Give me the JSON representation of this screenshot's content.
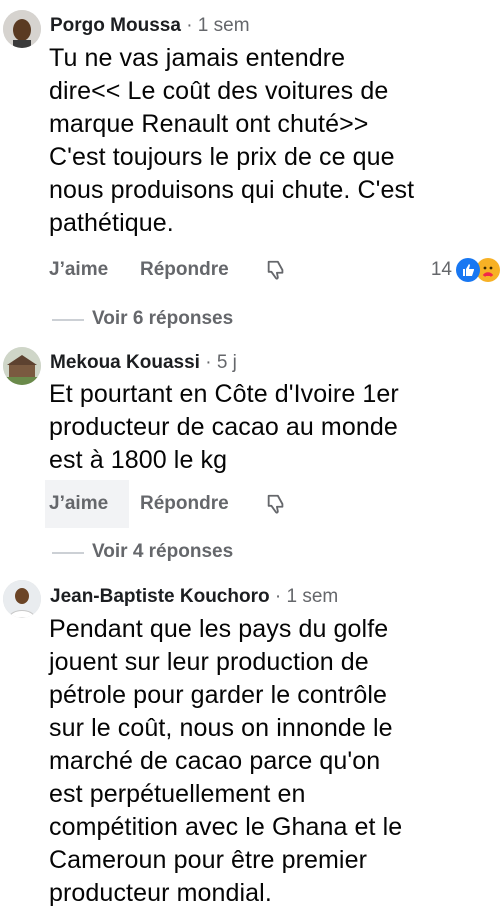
{
  "comments": [
    {
      "author": "Porgo Moussa",
      "separator": "·",
      "time": "1 sem",
      "text_lines": [
        "Tu ne vas jamais entendre",
        "dire<< Le coût des voitures de",
        "marque Renault ont chuté>>",
        "C'est toujours le prix de ce que",
        "nous produisons qui chute. C'est",
        "pathétique."
      ],
      "like_label": "J’aime",
      "reply_label": "Répondre",
      "reaction_count": "14",
      "reactions": [
        "like-reaction-icon",
        "care-reaction-icon"
      ],
      "view_replies": "Voir 6 réponses"
    },
    {
      "author": "Mekoua Kouassi",
      "separator": "·",
      "time": "5 j",
      "text_lines": [
        "Et pourtant en Côte d'Ivoire 1er",
        "producteur de cacao au monde",
        "est à 1800 le kg"
      ],
      "like_label": "J’aime",
      "reply_label": "Répondre",
      "view_replies": "Voir 4 réponses"
    },
    {
      "author": "Jean-Baptiste Kouchoro",
      "separator": "·",
      "time": "1 sem",
      "text_lines": [
        "Pendant que les pays du golfe",
        "jouent sur leur production de",
        "pétrole pour garder le contrôle",
        "sur le coût, nous on innonde le",
        "marché de cacao parce qu'on",
        "est perpétuellement en",
        "compétition avec le Ghana et le",
        "Cameroun pour être premier",
        "producteur mondial."
      ]
    }
  ],
  "colors": {
    "text": "#050505",
    "secondary": "#65676b",
    "like_blue": "#1877f2",
    "care_yellow": "#f7b125",
    "divider": "#ccd0d5"
  }
}
